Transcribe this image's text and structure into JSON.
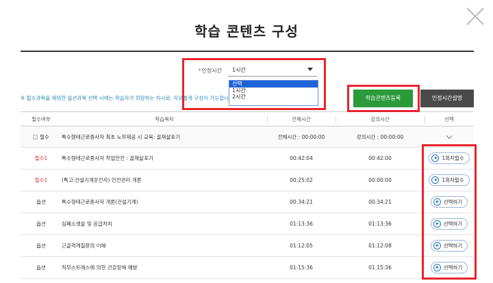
{
  "page_title": "학습 콘텐츠 구성",
  "icons": {
    "close": "close-icon",
    "play": "play-circle-icon",
    "checkbox": "checkbox-icon",
    "expand": "chevron-down-icon"
  },
  "accred": {
    "required_mark": "*",
    "label": "인정시간",
    "selected_value": "1시간",
    "options": [
      "선택",
      "1시간",
      "2시간"
    ],
    "highlighted_option": "선택"
  },
  "notice": "※ 필수과목을 제외한 옵션과목 선택 시에는 학습자가 희망하는 차시로, 자유롭게 구성이 가능합니",
  "buttons": {
    "register": "학습콘텐츠등록",
    "explain": "인정시간설명"
  },
  "table": {
    "headers": {
      "required": "필수여부",
      "name": "학습목차",
      "total": "전체시간",
      "lecture": "강의시간",
      "select": "선택"
    },
    "top_item": {
      "required": "필수",
      "name": "특수형태근로종사자 최초 노무제공 시 교육: 골재살포기",
      "total": "전체시간 : 00:00:00",
      "lecture": "강의시간 : 00:00:00"
    },
    "rows": [
      {
        "required": "필수1",
        "name": "특수형태근로종사자 작업안전 : 골재살포기",
        "total": "00:42:04",
        "lecture": "00:42:00",
        "action": "1회차필수"
      },
      {
        "required": "필수1",
        "name": "(특고:건설기계운전자) 안전관리 개론",
        "total": "00:25:02",
        "lecture": "00:00:00",
        "action": "1회차필수"
      },
      {
        "required": "옵션",
        "name": "특수형태근로종사자 개론(건설기계)",
        "total": "00:34:21",
        "lecture": "00:34:21",
        "action": "선택하기"
      },
      {
        "required": "옵션",
        "name": "심폐소생술 및 응급처치",
        "total": "01:13:36",
        "lecture": "01:13:36",
        "action": "선택하기"
      },
      {
        "required": "옵션",
        "name": "근골격계질환의 이해",
        "total": "01:12:05",
        "lecture": "01:12:08",
        "action": "선택하기"
      },
      {
        "required": "옵션",
        "name": "직무스트레스에 의한 건강장해 예방",
        "total": "01:15:36",
        "lecture": "01:15:36",
        "action": "선택하기"
      }
    ]
  },
  "colors": {
    "highlight": "#e8232a",
    "register_bg": "#2b9a3a",
    "explain_bg": "#4a4a4a",
    "required_text": "#d62b2b",
    "notice_text": "#2a8ab8",
    "select_highlight": "#1e63d6"
  }
}
